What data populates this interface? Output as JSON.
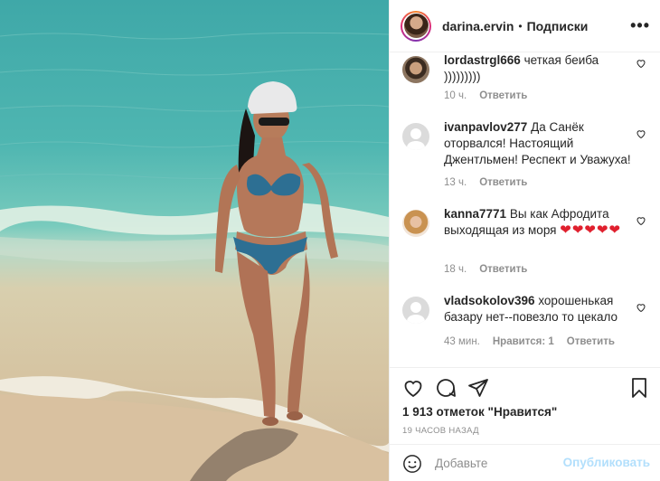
{
  "header": {
    "username": "darina.ervin",
    "separator": "•",
    "follow_label": "Подписки",
    "more_label": "•••"
  },
  "comments": [
    {
      "username": "lordastrgl666",
      "text": "четкая беиба )))))))))",
      "time": "10 ч.",
      "reply_label": "Ответить",
      "likes_label": ""
    },
    {
      "username": "ivanpavlov277",
      "text": "Да Санёк оторвался! Настоящий Джентльмен! Респект и Уважуха!",
      "time": "13 ч.",
      "reply_label": "Ответить",
      "likes_label": ""
    },
    {
      "username": "kanna7771",
      "text": "Вы как Афродита выходящая из моря",
      "hearts": "❤❤❤❤❤",
      "time": "18 ч.",
      "reply_label": "Ответить",
      "likes_label": ""
    },
    {
      "username": "vladsokolov396",
      "text": "хорошенькая базару нет--повезло то цекало",
      "time": "43 мин.",
      "likes_label": "Нравится: 1",
      "reply_label": "Ответить"
    }
  ],
  "post": {
    "likes_text": "1 913 отметок \"Нравится\"",
    "time_ago": "19 ЧАСОВ НАЗАД"
  },
  "composer": {
    "placeholder": "Добавьте",
    "publish_label": "Опубликовать"
  },
  "colors": {
    "publish_disabled": "#b2dffc",
    "heart_red": "#e0202e"
  }
}
